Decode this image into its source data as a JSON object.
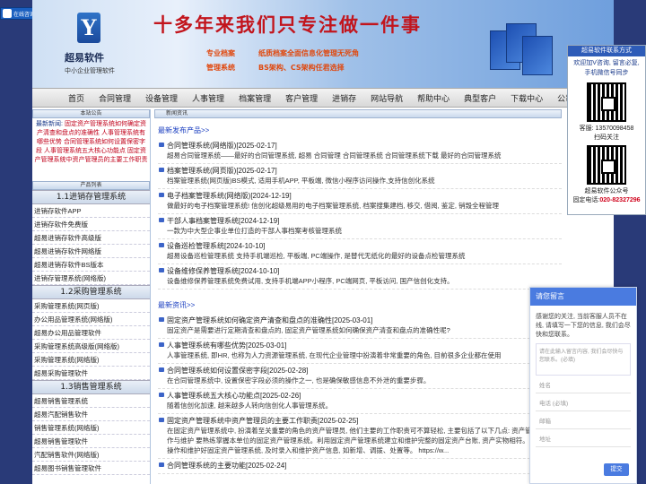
{
  "consult": {
    "label": "在线咨询"
  },
  "header": {
    "logo_name": "超易软件",
    "logo_sub": "中小企业管理软件",
    "logo_letter": "Y",
    "slogan": "十多年来我们只专注做一件事",
    "tags": [
      "专业档案",
      "纸质档案全面信息化管理无死角",
      "管理系统",
      "BS架构、CS架构任君选择"
    ]
  },
  "nav": [
    "首页",
    "合同管理",
    "设备管理",
    "人事管理",
    "档案管理",
    "客户管理",
    "进销存",
    "网站导航",
    "帮助中心",
    "典型客户",
    "下载中心",
    "公司"
  ],
  "left": {
    "notice_header": "本站公告",
    "notice_label": "最新新闻:",
    "notice_text": "固定资产管理系统如何确定资产清查和盘点的准确性 人事管理系统有哪些优势 合同管理系统如何设置保密字段 人事管理系统五大核心功能点 固定资产管理系统中资产管理员的主要工作职责",
    "products_header": "产品列表",
    "categories": [
      {
        "title": "1.1进销存管理系统",
        "items": [
          "进销存软件APP",
          "进销存软件免费版",
          "超易进销存软件高级版",
          "超易进销存软件网络版",
          "超易进销存软件BS版本",
          "进销存管理系统(网络版)"
        ]
      },
      {
        "title": "1.2采购管理系统",
        "items": [
          "采购管理系统(网页版)",
          "办公用品管理系统(网络版)",
          "超易办公用品管理软件",
          "采购管理系统高级版(网络版)",
          "采购管理系统(网络版)",
          "超易采购管理软件"
        ]
      },
      {
        "title": "1.3销售管理系统",
        "items": [
          "超易销售管理系统",
          "超易汽配销售软件",
          "销售管理系统(网络版)",
          "超易销售管理软件",
          "汽配销售软件(网络版)",
          "超易图书销售管理软件"
        ]
      }
    ]
  },
  "center": {
    "header": "新闻资讯",
    "products_title": "最新发布产品>>",
    "products": [
      {
        "title": "合同管理系统(网络版)[2025-02-17]",
        "desc": "超易合同管理系统——最好的合同管理系统, 超易 合同管理 合同管理系统 合同管理系统下载 最好的合同管理系统"
      },
      {
        "title": "档案管理系统(网页版)[2025-02-17]",
        "desc": "档案管理系统(网页版)BS模式, 适用手机APP, 平板端, 微信小程序访问操作,支持信创化系统"
      },
      {
        "title": "电子档案管理系统(网络版)[2024-12-19]",
        "desc": "做最好的电子档案管理系统! 信创化超级易用的电子档案管理系统, 档案搜集建档, 移交, 借阅, 鉴定, 销毁全程管理"
      },
      {
        "title": "干部人事档案管理系统[2024-12-19]",
        "desc": "一款为中大型企事业单位打造的干部人事档案考核管理系统"
      },
      {
        "title": "设备巡检管理系统[2024-10-10]",
        "desc": "超易设备巡检管理系统 支持手机端巡检, 平板端, PC端操作, 是替代无纸化的最好的设备点检管理系统"
      },
      {
        "title": "设备维修保养管理系统[2024-10-10]",
        "desc": "设备维修保养管理系统免费试用, 支持手机端APP小程序, PC端网页, 平板访问, 国产信创化支持。"
      }
    ],
    "news_title": "最新资讯>>",
    "news": [
      {
        "title": "固定资产管理系统如何确定资产清查和盘点的准确性[2025-03-01]",
        "desc": "固定资产是需要进行定期清查和盘点的, 固定资产管理系统如何确保资产清查和盘点的准确性呢?"
      },
      {
        "title": "人事管理系统有哪些优势[2025-03-01]",
        "desc": "人事管理系统, 即HR, 也称为人力资源管理系统, 在现代企业管理中扮演着非常重要的角色, 目前很多企业都在使用"
      },
      {
        "title": "合同管理系统如何设置保密字段[2025-02-28]",
        "desc": "在合同管理系统中, 设置保密字段必须的操作之一, 也是确保敏感信息不外泄的重要步骤。"
      },
      {
        "title": "人事管理系统五大核心功能点[2025-02-26]",
        "desc": "随着信创化加速, 越来越多人转向信创化人事管理系统。"
      },
      {
        "title": "固定资产管理系统中资产管理员的主要工作职责[2025-02-25]",
        "desc": "在固定资产管理系统中, 扮演着至关重要的角色的资产管理员, 他们主要的工作职责可不算轻松, 主要包括了以下几点: 资产管理系统操作与维护 要熟练掌握本单位的固定资产管理系统。利用固定资产管理系统建立和维护完整的固定资产台账, 资产实物相符。能够正确操作和维护好固定资产管理系统, 及时录入和维护资产信息, 如新增、调拨、处置等。 https://w..."
      },
      {
        "title": "合同管理系统的主要功能[2025-02-24]",
        "desc": ""
      }
    ]
  },
  "right": {
    "header": "超易软件联系方式",
    "text": "欢迎加V咨询, 留言必复, 手机微信号同步",
    "service": "客服: 13570098458",
    "scan": "扫码关注",
    "account": "超易软件公众号",
    "phone_label": "固定电话:",
    "phone": "020-82327296"
  },
  "chat": {
    "header": "请您留言",
    "message": "感谢您的关注, 当前客服人员不在线, 请填写一下您的信息, 我们会尽快和您联系。",
    "content_placeholder": "请在此输入留言内容, 我们会尽快与您联系。(必填)",
    "fields": [
      "姓名",
      "电话 (必填)",
      "邮箱",
      "地址"
    ],
    "submit": "提交"
  }
}
